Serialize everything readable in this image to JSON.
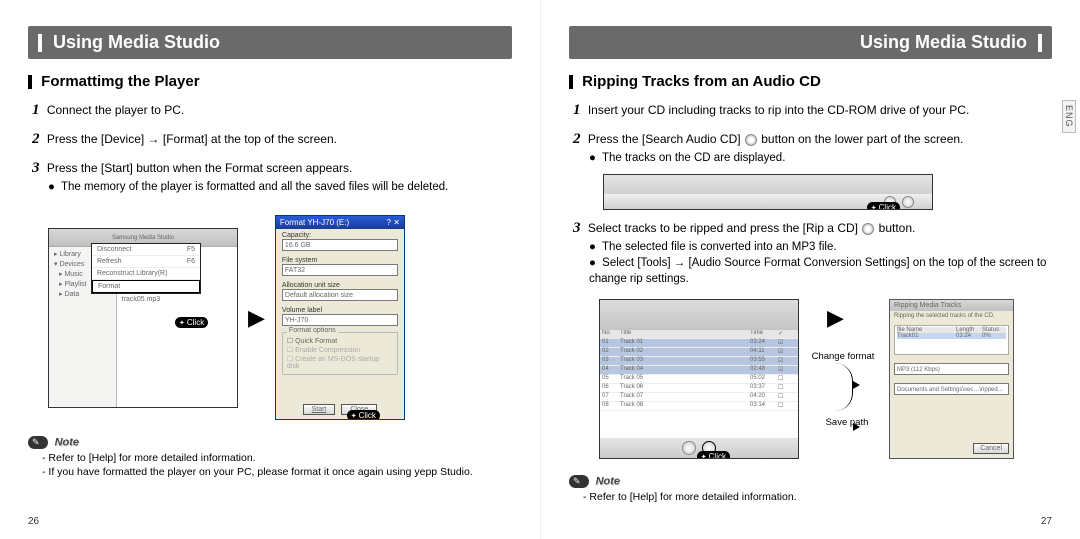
{
  "header": {
    "title_left": "Using Media Studio",
    "title_right": "Using Media Studio"
  },
  "eng_tab": "ENG",
  "left_page": {
    "section_title": "Formattimg the Player",
    "steps": [
      {
        "num": "1",
        "text": "Connect the player to PC."
      },
      {
        "num": "2",
        "text": "Press the [Device] → [Format] at the top of the screen."
      },
      {
        "num": "3",
        "text": "Press the [Start] button when the Format screen appears."
      }
    ],
    "step3_sub": "The memory of the player is formatted and all the saved files will be deleted.",
    "popup_menu": {
      "items": [
        {
          "label": "Disconnect",
          "shortcut": "F5"
        },
        {
          "label": "Refresh",
          "shortcut": "F6"
        },
        {
          "label": "Reconstruct Library(R)",
          "shortcut": ""
        },
        {
          "label": "Format",
          "shortcut": ""
        }
      ]
    },
    "format_dialog": {
      "title": "Format YH-J70 (E:)",
      "capacity_label": "Capacity:",
      "capacity_value": "16.6 GB",
      "filesystem_label": "File system",
      "filesystem_value": "FAT32",
      "alloc_label": "Allocation unit size",
      "alloc_value": "Default allocation size",
      "volume_label": "Volume label",
      "volume_value": "YH-J70",
      "options_title": "Format options",
      "opt_quick": "Quick Format",
      "opt_compress": "Enable Compression",
      "opt_msdos": "Create an MS-DOS startup disk",
      "btn_start": "Start",
      "btn_close": "Close"
    },
    "note_title": "Note",
    "note_items": [
      "Refer to [Help] for more detailed information.",
      "If you have formatted the player on your PC, please format it once again using yepp Studio."
    ],
    "page_no": "26"
  },
  "right_page": {
    "section_title": "Ripping Tracks from an Audio CD",
    "steps": [
      {
        "num": "1",
        "text": "Insert your CD including tracks to rip into the CD-ROM drive of your PC."
      },
      {
        "num": "2",
        "text": "Press the [Search Audio CD]        button on the lower part of the screen."
      },
      {
        "num": "3",
        "text": "Select tracks to be ripped and press the [Rip a CD]        button."
      }
    ],
    "step2_sub": "The tracks on the CD are displayed.",
    "step3_sub1": "The selected file is converted into an MP3 file.",
    "step3_sub2": "Select [Tools] → [Audio Source Format Conversion Settings] on the top of the screen to change rip settings.",
    "rip_dialog": {
      "title": "Ripping Media Tracks",
      "subtitle": "Ripping the selected tracks of the CD.",
      "col_name": "file Name",
      "col_length": "Length",
      "col_status": "Status",
      "format_value": "MP3 (112 Kbps)",
      "path_value": "Documents and Settings\\sec…\\ripped…",
      "btn_cancel": "Cancel"
    },
    "labels": {
      "change_format": "Change format",
      "save_path": "Save path"
    },
    "note_title": "Note",
    "note_items": [
      "Refer to [Help] for more detailed information."
    ],
    "page_no": "27"
  },
  "click_label": "Click"
}
